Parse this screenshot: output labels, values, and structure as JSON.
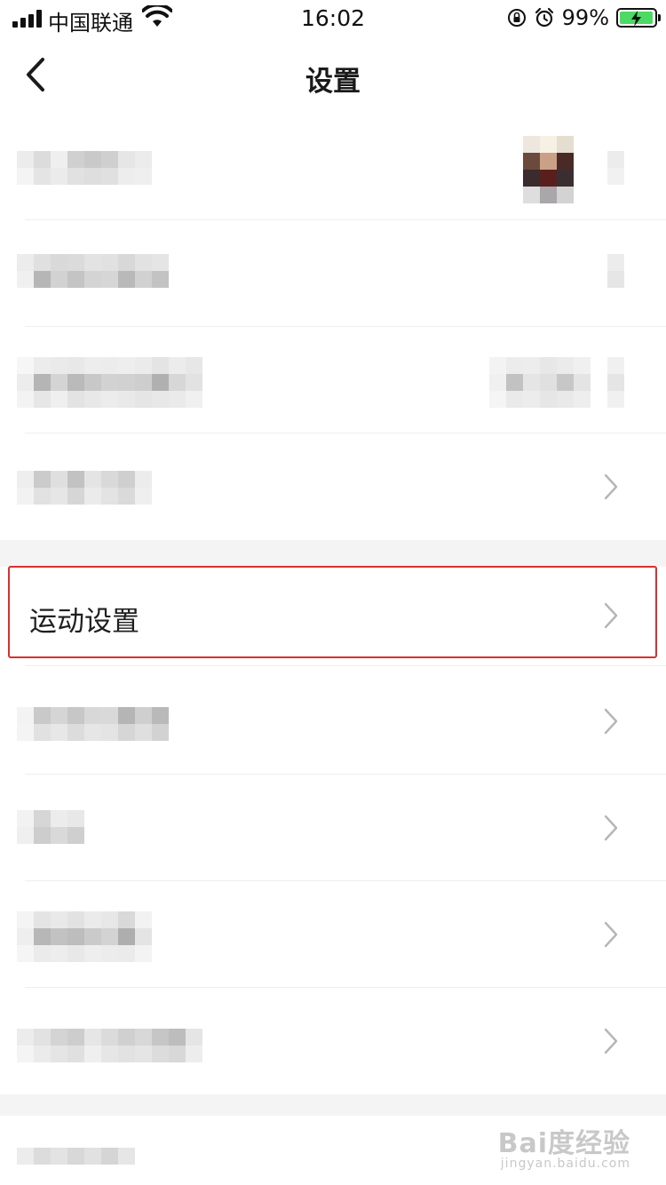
{
  "status_bar": {
    "carrier": "中国联通",
    "time": "16:02",
    "battery": "99%",
    "icons": [
      "signal-icon",
      "wifi-icon",
      "orientation-lock-icon",
      "alarm-icon",
      "battery-charging-icon"
    ]
  },
  "header": {
    "title": "设置",
    "back_icon": "chevron-left-icon"
  },
  "list": {
    "highlighted_item": "运动设置"
  },
  "watermark": {
    "brand": "Bai度经验",
    "url": "jingyan.baidu.com"
  },
  "colors": {
    "highlight_border": "#d9302c",
    "section_gap": "#f4f4f4",
    "chevron": "#b5b5b5",
    "battery_fill": "#4cd964"
  }
}
